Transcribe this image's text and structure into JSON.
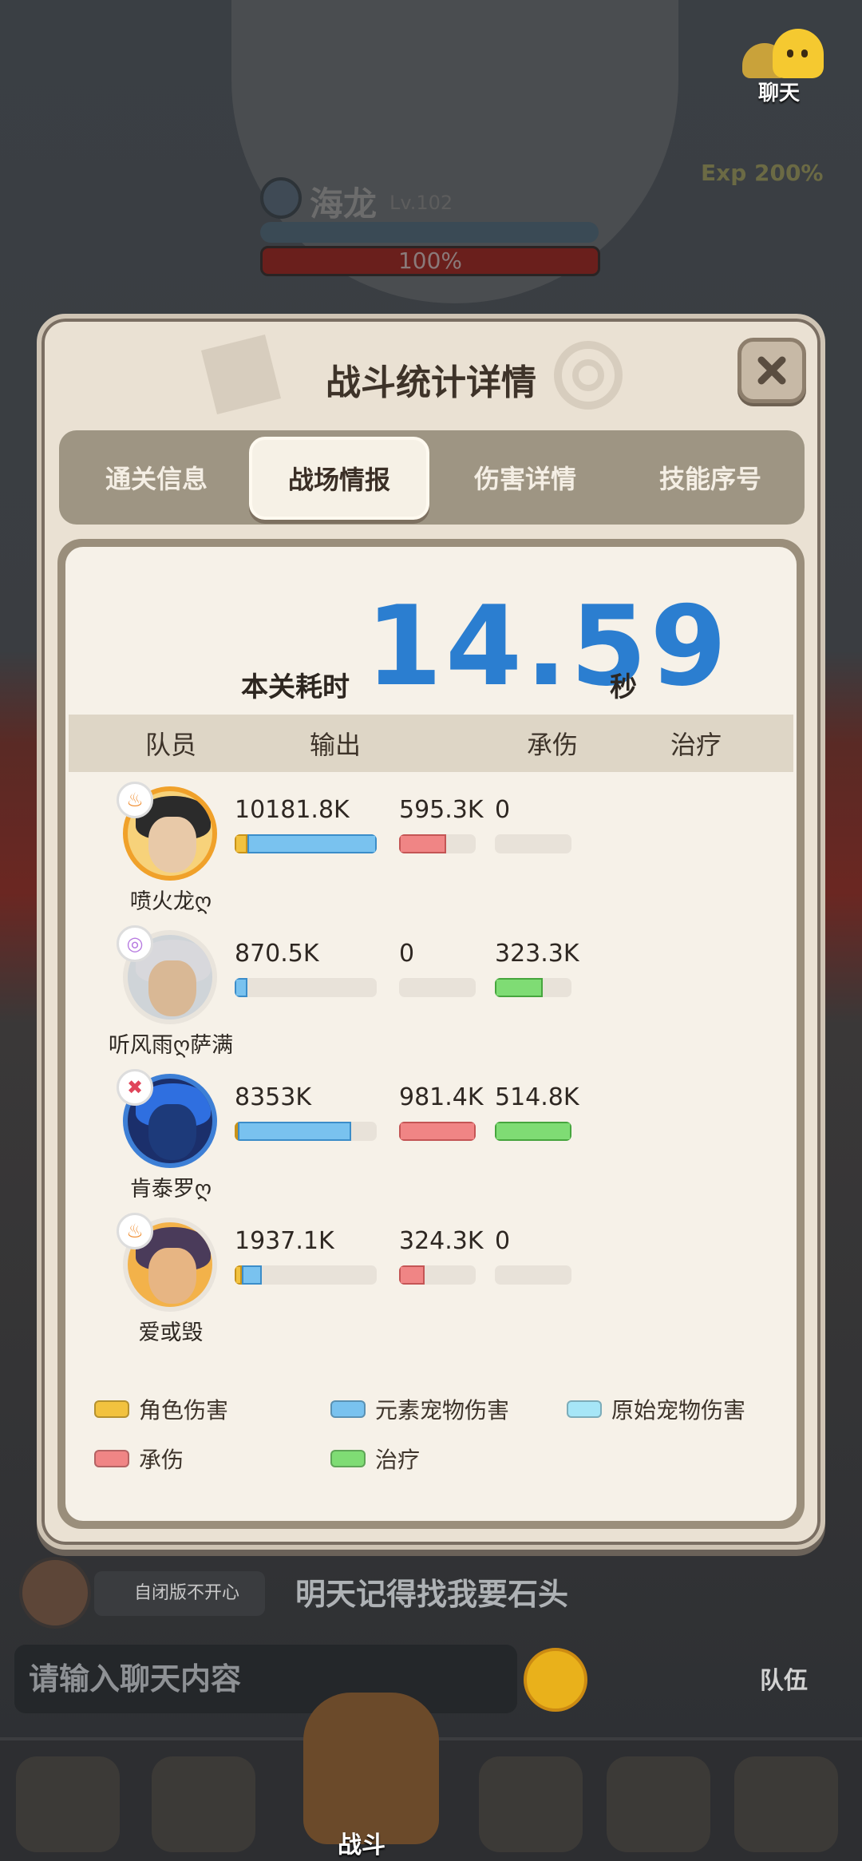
{
  "background": {
    "chat_button": "聊天",
    "boss_name": "海龙",
    "boss_level": "Lv.102",
    "boss_hp": "100%",
    "exp_bonus": "Exp 200%",
    "chat_user_tag": "自闭版不开心",
    "chat_message": "明天记得找我要石头",
    "chat_input_placeholder": "请输入聊天内容",
    "team_label": "队伍",
    "nav_battle_label": "战斗"
  },
  "dialog": {
    "title": "战斗统计详情",
    "tabs": [
      "通关信息",
      "战场情报",
      "伤害详情",
      "技能序号"
    ],
    "active_tab": "战场情报",
    "time_label": "本关耗时",
    "time_value": "14.59",
    "time_unit": "秒",
    "columns": [
      "队员",
      "输出",
      "承伤",
      "治疗"
    ],
    "members": [
      {
        "name": "喷火龙ღ",
        "badge": "fire",
        "output": "10181.8K",
        "taken": "595.3K",
        "heal": "0",
        "output_role_frac": 0.09,
        "output_elem_frac": 0.91,
        "taken_frac": 0.61,
        "heal_frac": 0.0
      },
      {
        "name": "听风雨ღ萨满",
        "badge": "wind",
        "output": "870.5K",
        "taken": "0",
        "heal": "323.3K",
        "output_role_frac": 0.0,
        "output_elem_frac": 0.09,
        "taken_frac": 0.0,
        "heal_frac": 0.63
      },
      {
        "name": "肯泰罗ღ",
        "badge": "strike",
        "output": "8353K",
        "taken": "981.4K",
        "heal": "514.8K",
        "output_role_frac": 0.02,
        "output_elem_frac": 0.8,
        "taken_frac": 1.0,
        "heal_frac": 1.0
      },
      {
        "name": "爱或毁",
        "badge": "fire",
        "output": "1937.1K",
        "taken": "324.3K",
        "heal": "0",
        "output_role_frac": 0.05,
        "output_elem_frac": 0.14,
        "taken_frac": 0.33,
        "heal_frac": 0.0
      }
    ],
    "legend": [
      {
        "label": "角色伤害",
        "color": "#f2c23f"
      },
      {
        "label": "元素宠物伤害",
        "color": "#79c2ef"
      },
      {
        "label": "原始宠物伤害",
        "color": "#a6e6f7"
      },
      {
        "label": "承伤",
        "color": "#f08585"
      },
      {
        "label": "治疗",
        "color": "#7fdc74"
      }
    ]
  }
}
